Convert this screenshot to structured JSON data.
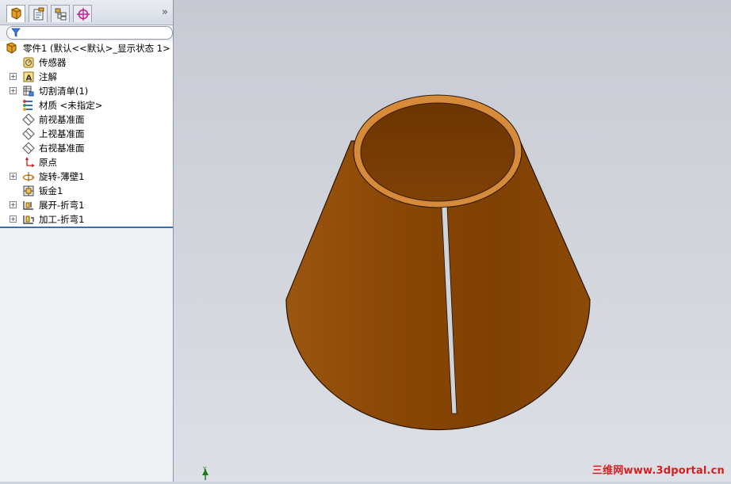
{
  "tabs": [
    {
      "name": "feature-manager",
      "icon": "feature-tree-icon",
      "active": true
    },
    {
      "name": "property-manager",
      "icon": "property-icon",
      "active": false
    },
    {
      "name": "configuration-manager",
      "icon": "configuration-icon",
      "active": false
    },
    {
      "name": "dim-xpert",
      "icon": "crosshair-icon",
      "active": false
    }
  ],
  "tabbar_more": "»",
  "tree": {
    "root": "零件1  (默认<<默认>_显示状态 1>",
    "items": [
      {
        "label": "传感器",
        "icon": "sensor-icon",
        "expandable": false
      },
      {
        "label": "注解",
        "icon": "annotation-icon",
        "expandable": true
      },
      {
        "label": "切割清单(1)",
        "icon": "cut-list-icon",
        "expandable": true
      },
      {
        "label": "材质 <未指定>",
        "icon": "material-icon",
        "expandable": false
      },
      {
        "label": "前视基准面",
        "icon": "plane-icon",
        "expandable": false
      },
      {
        "label": "上视基准面",
        "icon": "plane-icon",
        "expandable": false
      },
      {
        "label": "右视基准面",
        "icon": "plane-icon",
        "expandable": false
      },
      {
        "label": "原点",
        "icon": "origin-icon",
        "expandable": false
      },
      {
        "label": "旋转-薄壁1",
        "icon": "revolve-icon",
        "expandable": true
      },
      {
        "label": "钣金1",
        "icon": "sheet-metal-icon",
        "expandable": false
      },
      {
        "label": "展开-折弯1",
        "icon": "flatten-bend-icon",
        "expandable": true
      },
      {
        "label": "加工-折弯1",
        "icon": "process-bend-icon",
        "expandable": true
      }
    ]
  },
  "colors": {
    "part_body": "#8a4a06",
    "part_rim": "#d9913f",
    "part_inner": "#7a3d05",
    "viewport_bg": "#cfd3db"
  },
  "watermark": "三维网www.3dportal.cn"
}
